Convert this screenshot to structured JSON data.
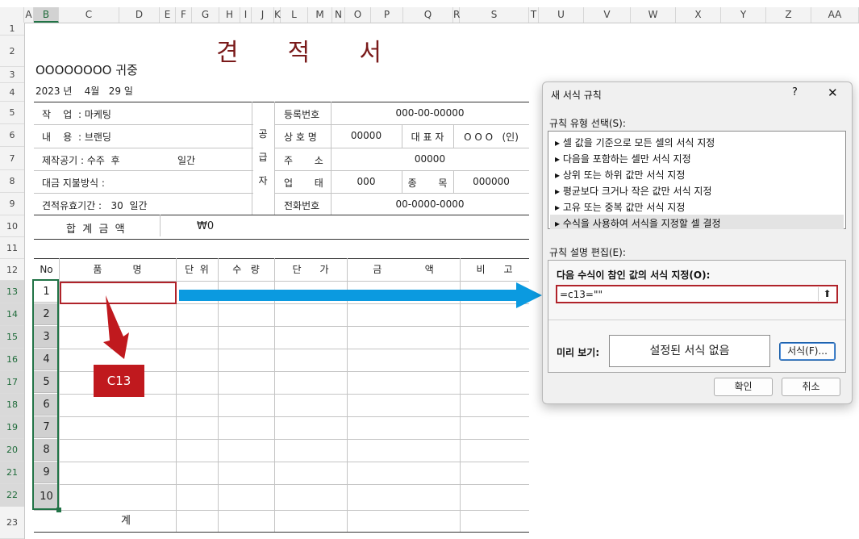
{
  "columns": [
    "A",
    "B",
    "C",
    "D",
    "E",
    "F",
    "G",
    "H",
    "I",
    "J",
    "K",
    "L",
    "M",
    "N",
    "O",
    "P",
    "Q",
    "R",
    "S",
    "T",
    "U",
    "V",
    "W",
    "X",
    "Y",
    "Z",
    "AA"
  ],
  "rows": [
    "1",
    "2",
    "3",
    "4",
    "5",
    "6",
    "7",
    "8",
    "9",
    "10",
    "11",
    "12",
    "13",
    "14",
    "15",
    "16",
    "17",
    "18",
    "19",
    "20",
    "21",
    "22",
    "23"
  ],
  "doc": {
    "title": "견  적  서",
    "recipient": "OOOOOOOO 귀중",
    "date": "2023 년    4월   29 일",
    "left_info": [
      "작    업  : 마케팅",
      "내    용  : 브랜딩",
      "제작공기 : 수주  후",
      "대금 지불방식 :",
      "견적유효기간 :   30  일간"
    ],
    "period": "일간",
    "supplier": "공급자",
    "reg_label": "등록번호",
    "reg_value": "000-00-00000",
    "company_label": "상 호 명",
    "company_value": "00000",
    "ceo_label": "대 표 자",
    "ceo_value": "O O O   (인)",
    "addr_label": "주       소",
    "addr_value": "00000",
    "biz_label": "업       태",
    "biz_value": "000",
    "item_label": "종       목",
    "item_value": "000000",
    "tel_label": "전화번호",
    "tel_value": "00-0000-0000",
    "total_label": "합  계  금  액",
    "total_value": "₩0",
    "table_headers": [
      "No",
      "품          명",
      "단  위",
      "수   량",
      "단      가",
      "금              액",
      "비      고"
    ],
    "numbers": [
      "1",
      "2",
      "3",
      "4",
      "5",
      "6",
      "7",
      "8",
      "9",
      "10"
    ],
    "sum_label": "계"
  },
  "callout": {
    "label": "C13",
    "color": "#c0191e"
  },
  "arrow_color": "#0b9ae0",
  "dialog": {
    "title": "새 서식 규칙",
    "help": "?",
    "close": "✕",
    "rule_type_label": "규칙 유형 선택(S):",
    "rule_types": [
      "▸ 셀 값을 기준으로 모든 셀의 서식 지정",
      "▸ 다음을 포함하는 셀만 서식 지정",
      "▸ 상위 또는 하위 값만 서식 지정",
      "▸ 평균보다 크거나 작은 값만 서식 지정",
      "▸ 고유 또는 중복 값만 서식 지정",
      "▸ 수식을 사용하여 서식을 지정할 셀 결정"
    ],
    "edit_label": "규칙 설명 편집(E):",
    "formula_label": "다음 수식이 참인 값의 서식 지정(O):",
    "formula_value": "=c13=\"\"",
    "preview_label": "미리 보기:",
    "preview_text": "설정된 서식 없음",
    "format_button": "서식(F)...",
    "ok_button": "확인",
    "cancel_button": "취소"
  }
}
